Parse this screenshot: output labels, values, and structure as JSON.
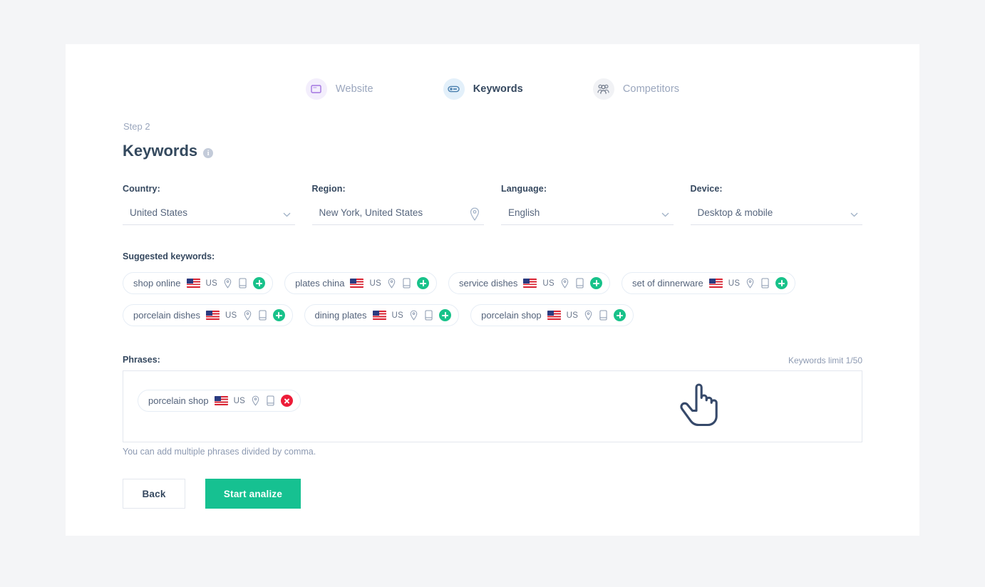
{
  "steps": [
    {
      "label": "Website",
      "icon": "monitor-icon",
      "state": "inactive"
    },
    {
      "label": "Keywords",
      "icon": "keyword-pill-icon",
      "state": "active"
    },
    {
      "label": "Competitors",
      "icon": "competitors-group-icon",
      "state": "inactive"
    }
  ],
  "header": {
    "step_number": "Step 2",
    "title": "Keywords",
    "info_glyph": "i"
  },
  "fields": [
    {
      "label": "Country:",
      "value": "United States",
      "control": "dropdown"
    },
    {
      "label": "Region:",
      "value": "New York, United States",
      "control": "location"
    },
    {
      "label": "Language:",
      "value": "English",
      "control": "dropdown"
    },
    {
      "label": "Device:",
      "value": "Desktop & mobile",
      "control": "dropdown"
    }
  ],
  "suggested": {
    "label": "Suggested keywords:",
    "chips": [
      {
        "text": "shop online",
        "country": "US"
      },
      {
        "text": "plates china",
        "country": "US"
      },
      {
        "text": "service dishes",
        "country": "US"
      },
      {
        "text": "set of dinnerware",
        "country": "US"
      },
      {
        "text": "porcelain dishes",
        "country": "US"
      },
      {
        "text": "dining plates",
        "country": "US"
      },
      {
        "text": "porcelain shop",
        "country": "US"
      }
    ]
  },
  "phrases": {
    "label": "Phrases:",
    "limit": "Keywords limit 1/50",
    "items": [
      {
        "text": "porcelain shop",
        "country": "US"
      }
    ],
    "hint": "You can add multiple phrases divided by comma."
  },
  "actions": {
    "back": "Back",
    "start": "Start analize"
  },
  "colors": {
    "accent_green": "#16c191",
    "remove_red": "#ed1c38",
    "add_green": "#18c28a",
    "title": "#34495e"
  }
}
